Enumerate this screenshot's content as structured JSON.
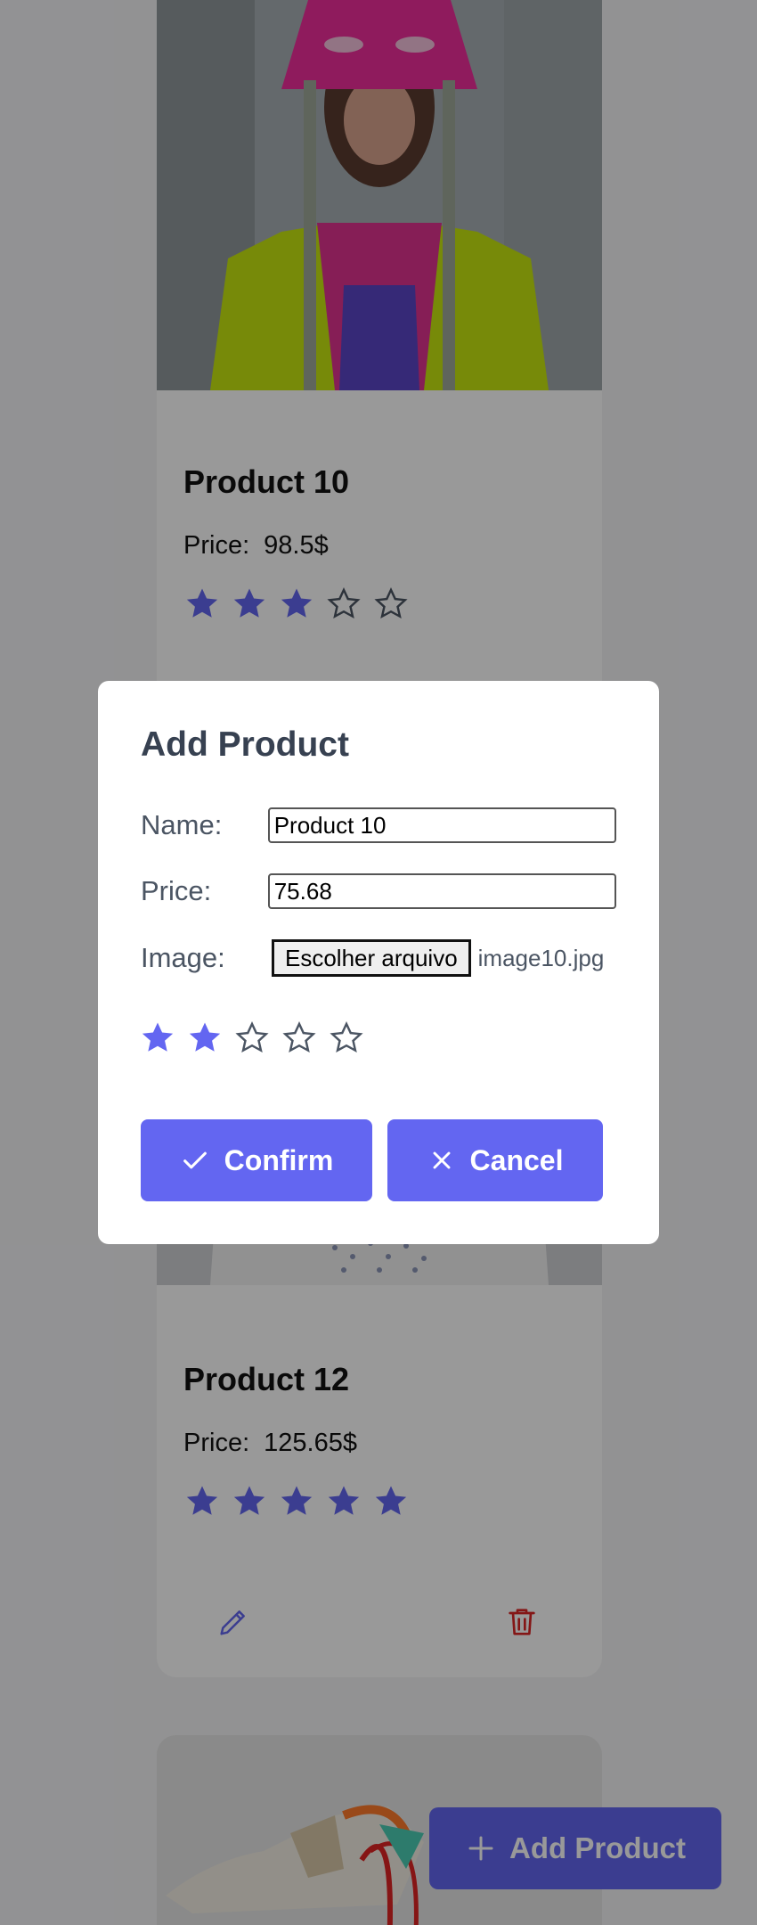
{
  "products": [
    {
      "title": "Product 10",
      "price_label": "Price:",
      "price": "98.5$",
      "rating": 3
    },
    {
      "title": "Product 12",
      "price_label": "Price:",
      "price": "125.65$",
      "rating": 5
    }
  ],
  "modal": {
    "title": "Add Product",
    "name_label": "Name:",
    "name_value": "Product 10",
    "price_label": "Price:",
    "price_value": "75.68",
    "image_label": "Image:",
    "file_button": "Escolher arquivo",
    "file_name": "image10.jpg",
    "rating": 2,
    "confirm_label": "Confirm",
    "cancel_label": "Cancel"
  },
  "fab": {
    "label": "Add Product"
  },
  "colors": {
    "accent": "#6366f1",
    "danger": "#dc2626",
    "star_empty_stroke": "#4b5563"
  },
  "icons": {
    "edit": "pencil-icon",
    "delete": "trash-icon",
    "confirm": "check-icon",
    "cancel": "close-icon",
    "add": "plus-icon"
  }
}
